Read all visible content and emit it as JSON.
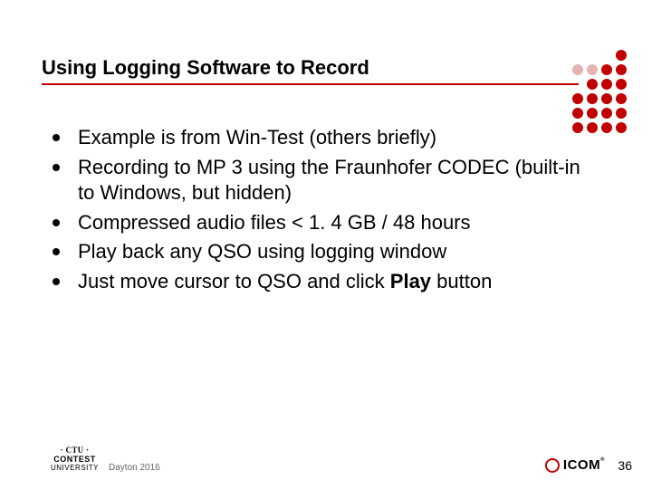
{
  "title": "Using Logging Software to Record",
  "bullets": [
    {
      "text": "Example is from Win-Test (others briefly)"
    },
    {
      "text": "Recording to MP 3 using the Fraunhofer CODEC (built-in to Windows, but hidden)"
    },
    {
      "text": "Compressed audio files < 1. 4 GB / 48 hours"
    },
    {
      "text": "Play back any QSO using logging window"
    },
    {
      "prefix": "Just move cursor to QSO and click ",
      "bold": "Play",
      "suffix": " button"
    }
  ],
  "footer": {
    "logo_line1": "· CTU ·",
    "logo_line2": "CONTEST",
    "logo_line3": "UNIVERSITY",
    "center": "Dayton 2016",
    "brand": "ICOM",
    "page": "36"
  }
}
